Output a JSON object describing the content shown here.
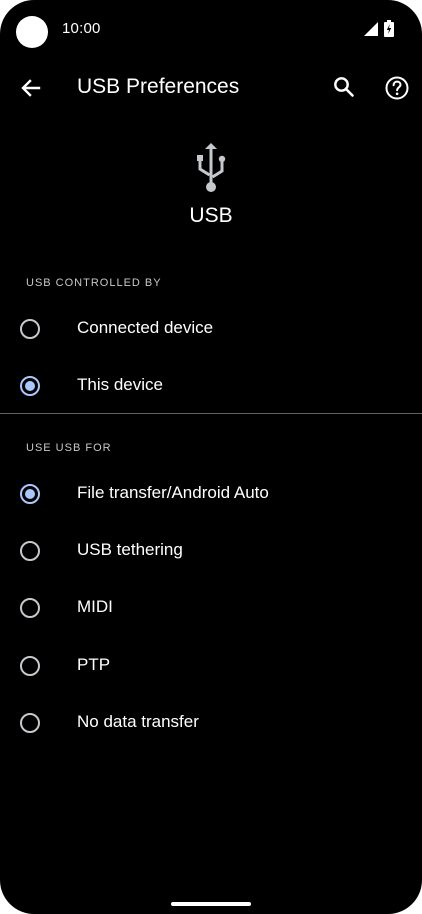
{
  "status_bar": {
    "time": "10:00",
    "icons": [
      "camera-dot",
      "cellular-signal-icon",
      "battery-charging-icon"
    ]
  },
  "app_bar": {
    "title": "USB Preferences",
    "icons": [
      "back-arrow-icon",
      "search-icon",
      "help-icon"
    ]
  },
  "header": {
    "icon": "usb-icon",
    "title": "USB"
  },
  "usb_controlled_by": {
    "header": "USB CONTROLLED BY",
    "options": [
      {
        "label": "Connected device",
        "selected": false
      },
      {
        "label": "This device",
        "selected": true
      }
    ]
  },
  "use_usb_for": {
    "header": "USE USB FOR",
    "options": [
      {
        "label": "File transfer/Android Auto",
        "selected": true
      },
      {
        "label": "USB tethering",
        "selected": false
      },
      {
        "label": "MIDI",
        "selected": false
      },
      {
        "label": "PTP",
        "selected": false
      },
      {
        "label": "No data transfer",
        "selected": false
      }
    ]
  },
  "colors": {
    "background": "#000000",
    "text": "#ffffff",
    "secondary_text": "#c5c8cc",
    "accent": "#a8c7fa",
    "divider": "#5f6368"
  }
}
